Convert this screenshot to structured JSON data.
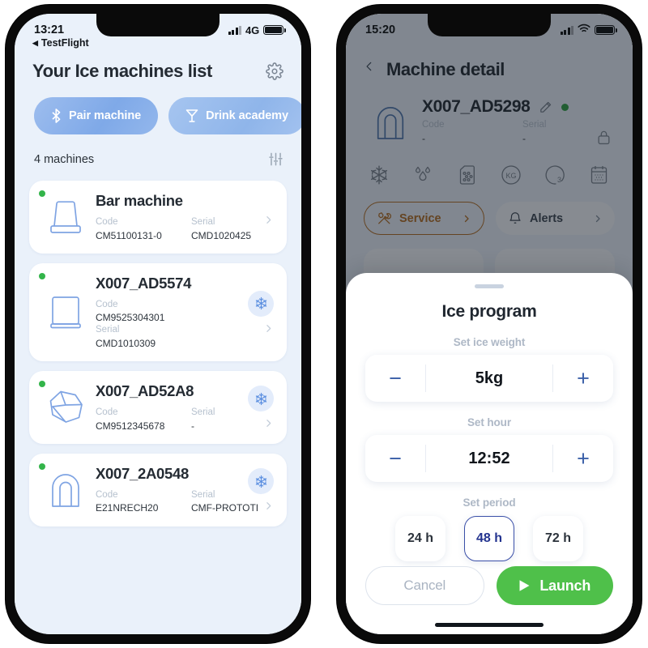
{
  "left_phone": {
    "status": {
      "time": "13:21",
      "network": "4G",
      "carrier_icon": "signal-bars-icon",
      "battery_icon": "battery-full-icon"
    },
    "testflight": {
      "label": "TestFlight",
      "icon": "back-arrow-icon"
    },
    "header": {
      "title": "Your Ice machines list",
      "settings_icon": "gear-icon"
    },
    "chips": [
      {
        "label": "Pair machine",
        "icon": "bluetooth-icon"
      },
      {
        "label": "Drink academy",
        "icon": "cocktail-glass-icon"
      }
    ],
    "count_row": {
      "label": "4 machines",
      "filter_icon": "sliders-icon"
    },
    "meta_keys": {
      "code": "Code",
      "serial": "Serial"
    },
    "machines": [
      {
        "name": "Bar machine",
        "code": "CM51100131-0",
        "serial": "CMD1020425",
        "status": "online",
        "thumb_icon": "bar-machine-icon",
        "has_snow_badge": false,
        "layout": "inline"
      },
      {
        "name": "X007_AD5574",
        "code": "CM9525304301",
        "serial": "CMD1010309",
        "status": "online",
        "thumb_icon": "cube-machine-icon",
        "has_snow_badge": true,
        "layout": "stacked"
      },
      {
        "name": "X007_AD52A8",
        "code": "CM9512345678",
        "serial": "-",
        "status": "online",
        "thumb_icon": "ice-nugget-icon",
        "has_snow_badge": true,
        "layout": "inline"
      },
      {
        "name": "X007_2A0548",
        "code": "E21NRECH20",
        "serial": "CMF-PROTOTI",
        "status": "online",
        "thumb_icon": "arch-machine-icon",
        "has_snow_badge": true,
        "layout": "inline"
      }
    ]
  },
  "right_phone": {
    "status": {
      "time": "15:20",
      "carrier_icon": "signal-bars-icon",
      "wifi_icon": "wifi-icon",
      "battery_icon": "battery-full-icon"
    },
    "nav": {
      "back_icon": "chevron-left-icon",
      "title": "Machine detail"
    },
    "hero": {
      "name": "X007_AD5298",
      "edit_icon": "pencil-icon",
      "status": "online",
      "thumb_icon": "arch-machine-icon",
      "lock_icon": "lock-icon",
      "code_label": "Code",
      "code_value": "-",
      "serial_label": "Serial",
      "serial_value": "-"
    },
    "metric_icons": [
      "snowflake-icon",
      "water-drops-icon",
      "filter-icon",
      "kg-icon",
      "gauge-icon",
      "calendar-ice-icon"
    ],
    "actions": [
      {
        "label": "Service",
        "icon": "tools-icon",
        "chevron": "chevron-right-icon",
        "accent": "#b26a1e"
      },
      {
        "label": "Alerts",
        "icon": "bell-icon",
        "chevron": "chevron-right-icon"
      }
    ],
    "tiles": [
      {
        "icon": "ice-bag-icon"
      },
      {
        "icon": "kg-gauge-icon"
      }
    ]
  },
  "sheet": {
    "grabber": "drag-handle",
    "title": "Ice program",
    "weight": {
      "label": "Set ice weight",
      "value": "5kg",
      "minus": "−",
      "plus": "+"
    },
    "hour": {
      "label": "Set hour",
      "value": "12:52",
      "minus": "−",
      "plus": "+"
    },
    "period": {
      "label": "Set period",
      "options": [
        {
          "label": "24 h",
          "selected": false
        },
        {
          "label": "48 h",
          "selected": true
        },
        {
          "label": "72 h",
          "selected": false
        }
      ]
    },
    "cancel_label": "Cancel",
    "launch_label": "Launch",
    "launch_icon": "play-icon"
  },
  "colors": {
    "app_bg": "#eaf1fa",
    "accent_blue": "#7fa9e8",
    "status_green": "#33b44a",
    "launch_green": "#4fc04a",
    "service_orange": "#b26a1e",
    "selected_blue": "#23338f"
  }
}
